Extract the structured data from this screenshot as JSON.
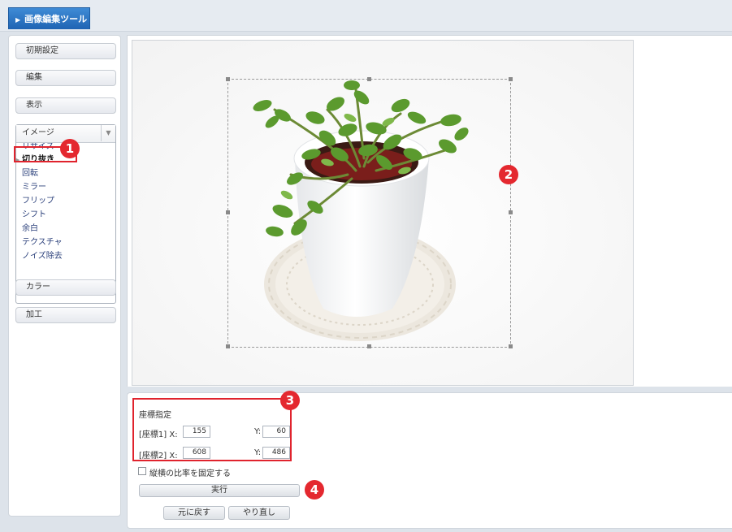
{
  "app": {
    "title": "画像編集ツール"
  },
  "sidebar": {
    "buttons": [
      {
        "label": "初期設定"
      },
      {
        "label": "編集"
      },
      {
        "label": "表示"
      },
      {
        "label": "カラー"
      },
      {
        "label": "加工"
      }
    ],
    "select": {
      "label": "イメージ",
      "options": [
        "リサイズ",
        "切り抜き",
        "回転",
        "ミラー",
        "フリップ",
        "シフト",
        "余白",
        "テクスチャ",
        "ノイズ除去"
      ],
      "selected": "切り抜き"
    }
  },
  "callouts": [
    "1",
    "2",
    "3",
    "4"
  ],
  "coords": {
    "heading": "座標指定",
    "row1": {
      "label": "[座標1] X:",
      "x": "155",
      "ylabel": "Y:",
      "y": "60"
    },
    "row2": {
      "label": "[座標2] X:",
      "x": "608",
      "ylabel": "Y:",
      "y": "486"
    }
  },
  "lock_ratio": {
    "label": "縦横の比率を固定する",
    "checked": false
  },
  "buttons": {
    "execute": "実行",
    "undo": "元に戻す",
    "redo": "やり直し"
  },
  "colors": {
    "accent": "#1f64b3",
    "callout": "#e4282f"
  }
}
